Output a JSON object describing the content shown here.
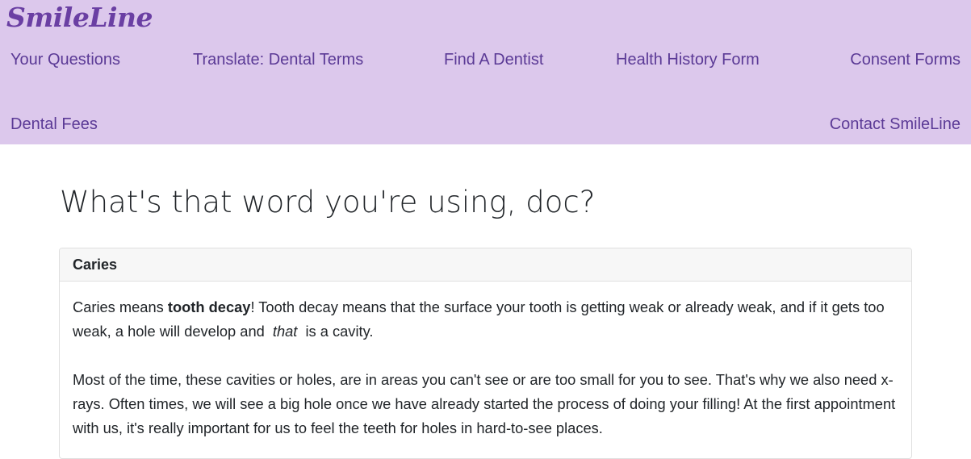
{
  "header": {
    "logo": "SmileLine",
    "nav": [
      {
        "label": "Your Questions"
      },
      {
        "label": "Translate: Dental Terms"
      },
      {
        "label": "Find A Dentist"
      },
      {
        "label": "Health History Form"
      },
      {
        "label": "Consent Forms"
      },
      {
        "label": "Dental Fees"
      },
      {
        "label": "Contact SmileLine"
      }
    ]
  },
  "colors": {
    "header_bg": "#dcc8ec",
    "brand": "#6a3fa3",
    "nav_text": "#5b3a96"
  },
  "main": {
    "title": "What's that word you're using, doc?",
    "card": {
      "header": "Caries",
      "p1": {
        "before": "Caries means ",
        "bold": "tooth decay",
        "middle": "! Tooth decay means that the surface your tooth is getting weak or already weak, and if it gets too weak, a hole will develop and ",
        "italic": "that",
        "after": " is a cavity."
      },
      "p2": "Most of the time, these cavities or holes, are in areas you can't see or are too small for you to see. That's why we also need x-rays. Often times, we will see a big hole once we have already started the process of doing your filling! At the first appointment with us, it's really important for us to feel the teeth for holes in hard-to-see places."
    }
  }
}
